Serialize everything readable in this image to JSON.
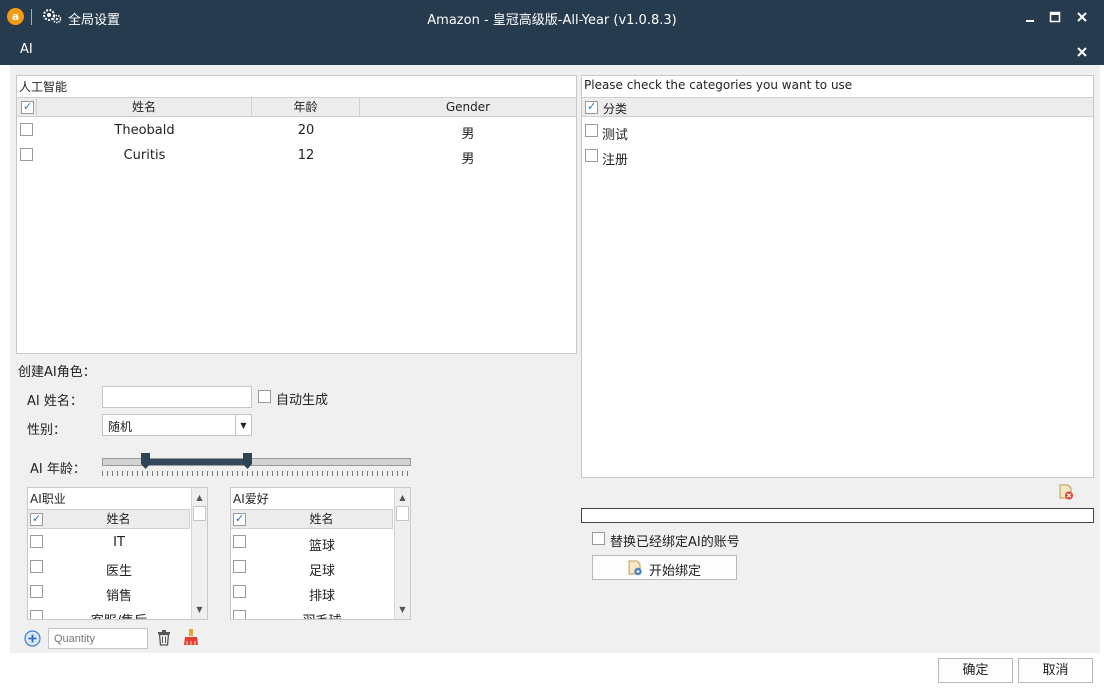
{
  "titlebar": {
    "logo_letter": "a",
    "settings_label": "全局设置",
    "window_title": "Amazon - 皇冠高级版-All-Year  (v1.0.8.3)"
  },
  "subbar": {
    "title": "AI"
  },
  "ai_panel": {
    "caption": "人工智能",
    "columns": [
      "姓名",
      "年龄",
      "Gender"
    ],
    "rows": [
      {
        "name": "Theobald",
        "age": "20",
        "gender": "男"
      },
      {
        "name": "Curitis",
        "age": "12",
        "gender": "男"
      }
    ]
  },
  "create": {
    "section_label": "创建AI角色：",
    "name_label": "AI 姓名：",
    "name_value": "",
    "auto_generate_label": "自动生成",
    "gender_label": "性别：",
    "gender_selected": "随机",
    "age_label": "AI 年龄：",
    "age_range_fraction": [
      0.14,
      0.47
    ]
  },
  "job_list": {
    "caption": "AI职业",
    "column": "姓名",
    "items": [
      "IT",
      "医生",
      "销售",
      "客服/售后"
    ]
  },
  "hobby_list": {
    "caption": "AI爱好",
    "column": "姓名",
    "items": [
      "篮球",
      "足球",
      "排球",
      "羽毛球"
    ]
  },
  "bottom_tools": {
    "quantity_placeholder": "Quantity"
  },
  "category_panel": {
    "caption": "Please check the categories you want to use",
    "column": "分类",
    "items": [
      "测试",
      "注册"
    ]
  },
  "bind": {
    "replace_label": "替换已经绑定AI的账号",
    "start_button": "开始绑定"
  },
  "footer": {
    "ok": "确定",
    "cancel": "取消"
  }
}
